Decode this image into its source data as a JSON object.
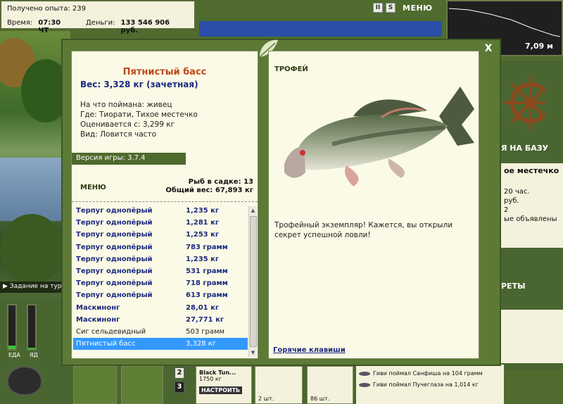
{
  "hud": {
    "experience": "Получено опыта: 239",
    "time_label": "Время:",
    "time_value": "07:30 ЧТ",
    "money_label": "Деньги:",
    "money_value": "133 546 906 руб.",
    "btn_pause": "II",
    "btn_sound": "S",
    "menu": "МЕНЮ",
    "depth": "7,09 м"
  },
  "background": {
    "base_heading": "Я НА БАЗУ",
    "location": "ое местечко",
    "info_lines": [
      "20 час.",
      "руб.",
      "2",
      "ые объявлены"
    ],
    "secrets_heading": "РЕТЫ",
    "task": "Задание на тур",
    "meter_food": "ЕДА",
    "meter_bait": "ЯД",
    "slot_2": "2",
    "slot_3": "3",
    "item_name": "Black Tun...",
    "item_weight": "1750 кг",
    "item_btn": "НАСТРОИТЬ",
    "item_count_1": "2 шт.",
    "item_count_2": "86 шт.",
    "feed": [
      "Гиви поймал Санфиша на 104 грамм",
      "Гиви поймал Пучеглаза на 1,014 кг"
    ]
  },
  "dialog": {
    "close": "X",
    "fish_name": "Пятнистый басс",
    "weight_line": "Вес: 3,328 кг (зачетная)",
    "details": [
      "На что поймана: живец",
      "Где: Тиорати, Тихое местечко",
      "Оценивается с: 3,299 кг",
      "Вид: Ловится часто"
    ],
    "version": "Версия игры: 3.7.4",
    "menu": "МЕНЮ",
    "fish_count": "Рыб в садке: 13",
    "total_weight": "Общий вес: 67,893 кг",
    "catch_list": [
      {
        "name": "Терпуг однопёрый",
        "weight": "1,235 кг",
        "style": "bold"
      },
      {
        "name": "Терпуг однопёрый",
        "weight": "1,281 кг",
        "style": "bold"
      },
      {
        "name": "Терпуг однопёрый",
        "weight": "1,253 кг",
        "style": "bold"
      },
      {
        "name": "Терпуг однопёрый",
        "weight": "783 грамм",
        "style": "bold"
      },
      {
        "name": "Терпуг однопёрый",
        "weight": "1,235 кг",
        "style": "bold"
      },
      {
        "name": "Терпуг однопёрый",
        "weight": "531 грамм",
        "style": "bold"
      },
      {
        "name": "Терпуг однопёрый",
        "weight": "718 грамм",
        "style": "bold"
      },
      {
        "name": "Терпуг однопёрый",
        "weight": "613 грамм",
        "style": "bold"
      },
      {
        "name": "Маскинонг",
        "weight": "28,01 кг",
        "style": "bold"
      },
      {
        "name": "Маскинонг",
        "weight": "27,771 кг",
        "style": "bold"
      },
      {
        "name": "Сиг сельдевидный",
        "weight": "503 грамм",
        "style": "plain"
      },
      {
        "name": "Пятнистый басс",
        "weight": "3,328 кг",
        "style": "selected"
      }
    ],
    "trophy_label": "ТРОФЕЙ",
    "trophy_text": "Трофейный экземпляр! Кажется, вы открыли секрет успешной ловли!",
    "hotkeys": "Горячие клавиши"
  },
  "colors": {
    "title": "#c0471a",
    "list_text": "#1b2a80",
    "selection": "#3399ff",
    "frame_green": "#5c7a36"
  }
}
